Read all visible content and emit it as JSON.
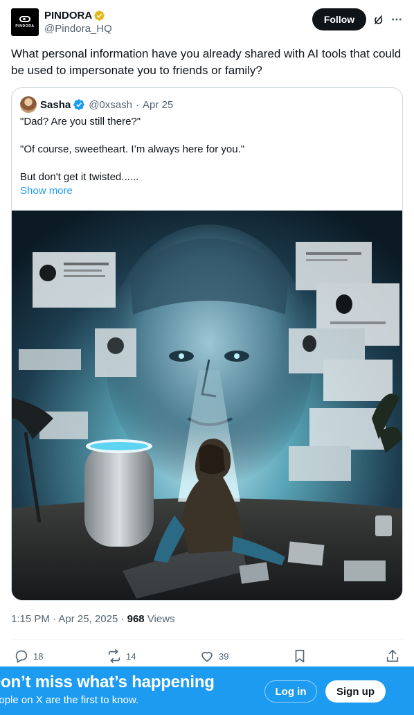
{
  "author": {
    "display_name": "PINDORA",
    "handle": "@Pindora_HQ",
    "avatar_wordmark": "PINDORA",
    "verified_badge": "gold-verified-badge-icon"
  },
  "header_actions": {
    "follow_label": "Follow",
    "grok_icon": "grok-icon",
    "more_icon": "more-icon"
  },
  "tweet": {
    "text": "What personal information have you already shared with AI tools that could be used to impersonate you to friends or family?"
  },
  "quoted": {
    "display_name": "Sasha",
    "handle": "@0xsash",
    "separator": "·",
    "date": "Apr 25",
    "lines": [
      "\"Dad? Are you still there?\"",
      "\"Of course, sweetheart. I’m always here for you.\"",
      "But don't get it twisted......"
    ],
    "show_more_label": "Show more"
  },
  "meta": {
    "time": "1:15 PM · Apr 25, 2025 ·",
    "views_count": "968",
    "views_label": "Views"
  },
  "actions": {
    "replies": "18",
    "reposts": "14",
    "likes": "39"
  },
  "banner": {
    "title": "Don’t miss what’s happening",
    "subtitle": "People on X are the first to know.",
    "login_label": "Log in",
    "signup_label": "Sign up"
  },
  "colors": {
    "accent": "#1d9bf0",
    "text_primary": "#0f1419",
    "text_secondary": "#536471",
    "border": "#cfd9de",
    "gold_badge": "#e2b719"
  }
}
